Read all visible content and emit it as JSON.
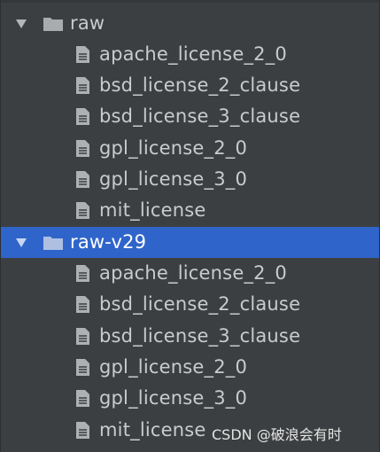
{
  "tree": {
    "folders": [
      {
        "label": "raw",
        "expanded": true,
        "selected": false,
        "files": [
          {
            "label": "apache_license_2_0"
          },
          {
            "label": "bsd_license_2_clause"
          },
          {
            "label": "bsd_license_3_clause"
          },
          {
            "label": "gpl_license_2_0"
          },
          {
            "label": "gpl_license_3_0"
          },
          {
            "label": "mit_license"
          }
        ]
      },
      {
        "label": "raw-v29",
        "expanded": true,
        "selected": true,
        "files": [
          {
            "label": "apache_license_2_0"
          },
          {
            "label": "bsd_license_2_clause"
          },
          {
            "label": "bsd_license_3_clause"
          },
          {
            "label": "gpl_license_2_0"
          },
          {
            "label": "gpl_license_3_0"
          },
          {
            "label": "mit_license"
          }
        ]
      }
    ]
  },
  "icons": {
    "chevron": "chevron-down-icon",
    "folder": "folder-icon",
    "file": "file-icon"
  },
  "colors": {
    "background": "#3c3f41",
    "selection": "#2f65ca",
    "text": "#c9cbcd",
    "icon": "#aeb1b3"
  },
  "watermark": "CSDN @破浪会有时"
}
